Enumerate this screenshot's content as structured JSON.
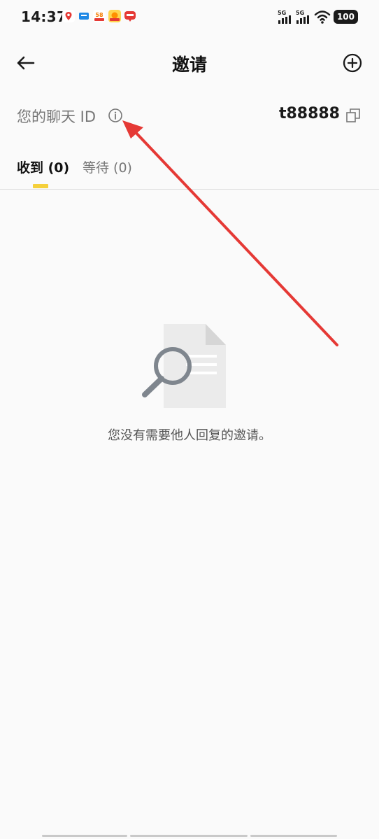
{
  "status_bar": {
    "time": "14:37",
    "signal1_label": "5G",
    "signal2_label": "5G",
    "battery": "100",
    "notification_icons": [
      "map-pin-icon",
      "chat-app-icon",
      "app-58-icon",
      "game-app-icon",
      "shopping-app-icon"
    ]
  },
  "header": {
    "title": "邀请",
    "back_icon": "arrow-left-icon",
    "add_icon": "plus-circle-icon"
  },
  "chat_id": {
    "label": "您的聊天 ID",
    "value": "t88888",
    "info_icon": "info-circle-icon",
    "copy_icon": "copy-icon"
  },
  "tabs": [
    {
      "label": "收到 (0)",
      "active": true
    },
    {
      "label": "等待 (0)",
      "active": false
    }
  ],
  "empty_state": {
    "message": "您没有需要他人回复的邀请。",
    "icon": "document-search-icon"
  },
  "colors": {
    "accent": "#f5d03b",
    "annotation": "#e53935",
    "background": "#fafafa"
  }
}
